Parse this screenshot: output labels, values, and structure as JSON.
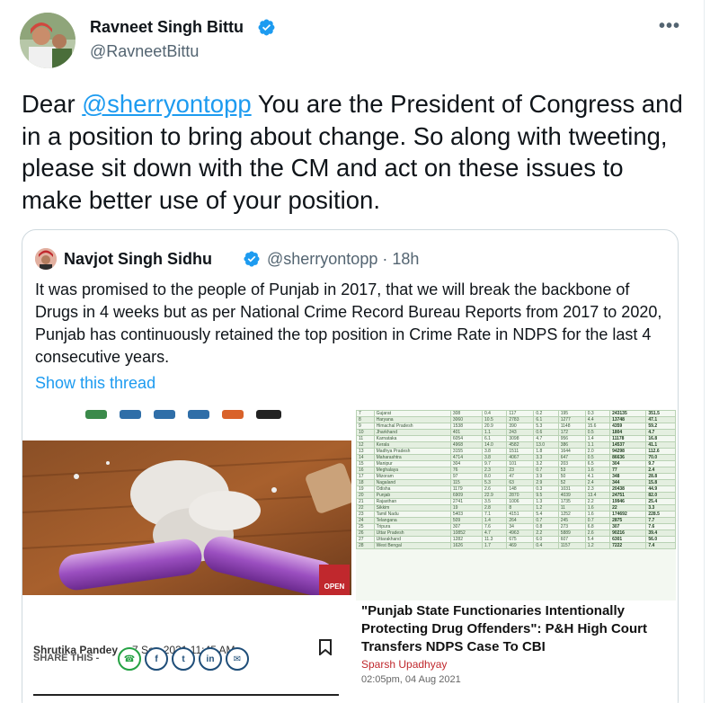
{
  "tweet": {
    "author_name": "Ravneet Singh Bittu",
    "author_handle": "@RavneetBittu",
    "more_label": "•••",
    "text_prefix": "Dear ",
    "mention": "@sherryontopp",
    "text_suffix": " You are the President of Congress and in a position to bring about change. So along with tweeting, please sit down with the CM and act on these issues to make better use of your position."
  },
  "quote": {
    "author_name": "Navjot Singh Sidhu",
    "author_handle": "@sherryontopp · 18h",
    "text": "It was promised to the people of Punjab in 2017, that we will break the backbone of Drugs in 4 weeks but as per National Crime Record Bureau Reports from 2017 to 2020, Punjab has continuously retained the top position in Crime Rate in NDPS for the last 4 consecutive years.",
    "show_thread": "Show this thread"
  },
  "left_article": {
    "open_label": "OPEN",
    "author": "Shrutika Pandey",
    "date": "7 Sep 2021 11:45 AM",
    "share_label": "SHARE THIS -",
    "share_icons": [
      "whatsapp-icon",
      "facebook-icon",
      "twitter-icon",
      "linkedin-icon",
      "email-icon"
    ],
    "share_glyphs": [
      "☎",
      "f",
      "t",
      "in",
      "✉"
    ]
  },
  "right_article": {
    "title": "\"Punjab State Functionaries Intentionally Protecting Drug Offenders\": P&H High Court Transfers NDPS Case To CBI",
    "author": "Sparsh Upadhyay",
    "date": "02:05pm, 04 Aug 2021"
  },
  "crime_table": {
    "rows": [
      [
        "7",
        "Gujarat",
        "308",
        "0.4",
        "117",
        "0.2",
        "195",
        "0.3",
        "243135",
        "351.5"
      ],
      [
        "8",
        "Haryana",
        "3060",
        "10.5",
        "2783",
        "6.1",
        "1277",
        "4.4",
        "13748",
        "47.1"
      ],
      [
        "9",
        "Himachal Pradesh",
        "1538",
        "20.9",
        "390",
        "5.3",
        "1148",
        "15.6",
        "4359",
        "59.2"
      ],
      [
        "10",
        "Jharkhand",
        "401",
        "1.1",
        "243",
        "0.6",
        "172",
        "0.5",
        "1804",
        "4.7"
      ],
      [
        "11",
        "Karnataka",
        "6054",
        "6.1",
        "3098",
        "4.7",
        "956",
        "1.4",
        "11178",
        "16.8"
      ],
      [
        "12",
        "Kerala",
        "4968",
        "14.0",
        "4582",
        "13.0",
        "386",
        "1.1",
        "14537",
        "41.1"
      ],
      [
        "13",
        "Madhya Pradesh",
        "3155",
        "3.8",
        "1511",
        "1.8",
        "1644",
        "2.0",
        "94298",
        "112.6"
      ],
      [
        "14",
        "Maharashtra",
        "4714",
        "3.8",
        "4067",
        "3.3",
        "647",
        "0.5",
        "86636",
        "70.0"
      ],
      [
        "15",
        "Manipur",
        "304",
        "9.7",
        "101",
        "3.2",
        "203",
        "6.5",
        "304",
        "9.7"
      ],
      [
        "16",
        "Meghalaya",
        "76",
        "2.3",
        "23",
        "0.7",
        "53",
        "1.6",
        "77",
        "2.4"
      ],
      [
        "17",
        "Mizoram",
        "97",
        "8.0",
        "47",
        "3.9",
        "50",
        "4.1",
        "348",
        "28.8"
      ],
      [
        "18",
        "Nagaland",
        "115",
        "5.3",
        "63",
        "2.9",
        "52",
        "2.4",
        "344",
        "15.8"
      ],
      [
        "19",
        "Odisha",
        "1179",
        "2.6",
        "148",
        "0.3",
        "1031",
        "2.3",
        "20438",
        "44.9"
      ],
      [
        "20",
        "Punjab",
        "6909",
        "22.9",
        "2870",
        "9.5",
        "4039",
        "13.4",
        "24751",
        "82.0"
      ],
      [
        "21",
        "Rajasthan",
        "2741",
        "3.5",
        "1006",
        "1.3",
        "1735",
        "2.2",
        "19946",
        "25.4"
      ],
      [
        "22",
        "Sikkim",
        "19",
        "2.8",
        "8",
        "1.2",
        "11",
        "1.6",
        "22",
        "3.3"
      ],
      [
        "23",
        "Tamil Nadu",
        "5403",
        "7.1",
        "4151",
        "5.4",
        "1252",
        "1.6",
        "174692",
        "228.5"
      ],
      [
        "24",
        "Telangana",
        "509",
        "1.4",
        "264",
        "0.7",
        "245",
        "0.7",
        "2875",
        "7.7"
      ],
      [
        "25",
        "Tripura",
        "307",
        "7.6",
        "34",
        "0.8",
        "273",
        "6.8",
        "307",
        "7.6"
      ],
      [
        "26",
        "Uttar Pradesh",
        "10852",
        "4.7",
        "4963",
        "2.2",
        "5889",
        "2.6",
        "90216",
        "39.4"
      ],
      [
        "27",
        "Uttarakhand",
        "1282",
        "11.3",
        "675",
        "6.0",
        "607",
        "5.4",
        "6301",
        "56.0"
      ],
      [
        "28",
        "West Bengal",
        "1626",
        "1.7",
        "469",
        "0.4",
        "1157",
        "1.2",
        "7222",
        "7.4"
      ]
    ]
  }
}
